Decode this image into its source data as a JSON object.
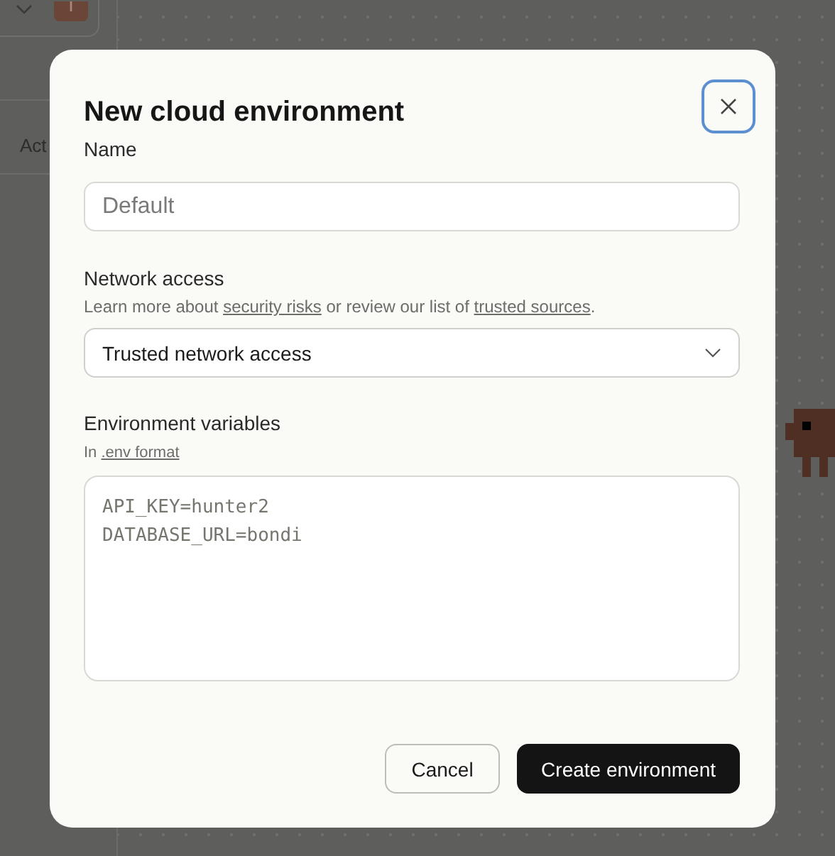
{
  "background": {
    "sidebar_text": "Act"
  },
  "dialog": {
    "title": "New cloud environment",
    "fields": [
      {
        "kind": "input",
        "label": "Name",
        "placeholder": "Default"
      },
      {
        "kind": "select",
        "label": "Network access",
        "help": [
          {
            "text": "Learn more about "
          },
          {
            "text": "security risks",
            "link": true
          },
          {
            "text": " or review our list of "
          },
          {
            "text": "trusted sources",
            "link": true
          },
          {
            "text": "."
          }
        ],
        "value": "Trusted network access"
      },
      {
        "kind": "textarea",
        "label": "Environment variables",
        "help": [
          {
            "text": "In "
          },
          {
            "text": ".env format",
            "link": true
          }
        ],
        "placeholder": "API_KEY=hunter2\nDATABASE_URL=bondi"
      }
    ],
    "buttons": [
      {
        "label": "Cancel",
        "kind": "secondary"
      },
      {
        "label": "Create environment",
        "kind": "primary"
      }
    ]
  }
}
